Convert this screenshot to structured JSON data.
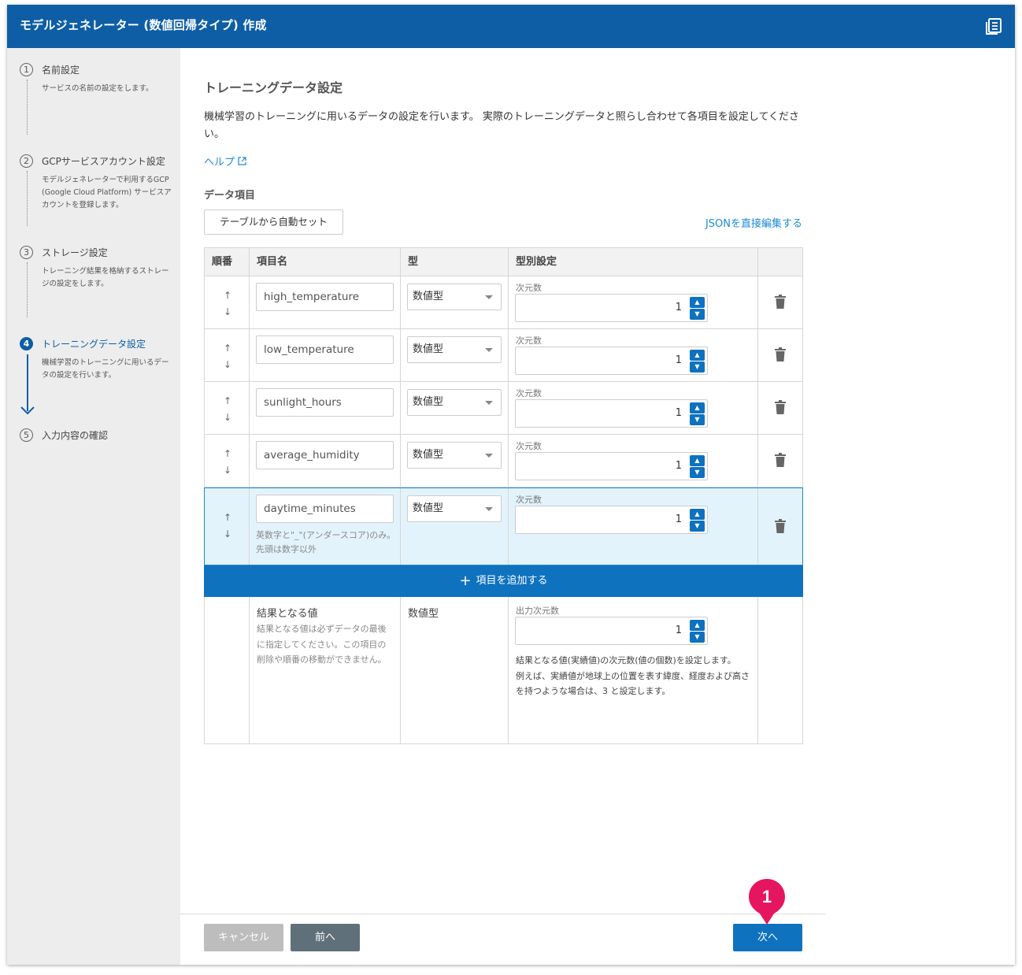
{
  "header": {
    "title": "モデルジェネレーター (数値回帰タイプ) 作成",
    "icon": "document-icon"
  },
  "sidebar": {
    "steps": [
      {
        "num": "1",
        "label": "名前設定",
        "desc": "サービスの名前の設定をします。"
      },
      {
        "num": "2",
        "label": "GCPサービスアカウント設定",
        "desc": "モデルジェネレーターで利用するGCP (Google Cloud Platform) サービスアカウントを登録します。"
      },
      {
        "num": "3",
        "label": "ストレージ設定",
        "desc": "トレーニング結果を格納するストレージの設定をします。"
      },
      {
        "num": "4",
        "label": "トレーニングデータ設定",
        "desc": "機械学習のトレーニングに用いるデータの設定を行います。"
      },
      {
        "num": "5",
        "label": "入力内容の確認",
        "desc": ""
      }
    ]
  },
  "main": {
    "title": "トレーニングデータ設定",
    "intro": "機械学習のトレーニングに用いるデータの設定を行います。 実際のトレーニングデータと照らし合わせて各項目を設定してください。",
    "help": "ヘルプ",
    "section": "データ項目",
    "auto_button": "テーブルから自動セット",
    "json_link": "JSONを直接編集する",
    "columns": {
      "order": "順番",
      "name": "項目名",
      "type": "型",
      "settings": "型別設定"
    },
    "dim_label": "次元数",
    "rows": [
      {
        "name": "high_temperature",
        "type": "数値型",
        "dim": "1"
      },
      {
        "name": "low_temperature",
        "type": "数値型",
        "dim": "1"
      },
      {
        "name": "sunlight_hours",
        "type": "数値型",
        "dim": "1"
      },
      {
        "name": "average_humidity",
        "type": "数値型",
        "dim": "1"
      },
      {
        "name": "daytime_minutes",
        "type": "数値型",
        "dim": "1",
        "hint": "英数字と\"_\"(アンダースコア)のみ。先頭は数字以外"
      }
    ],
    "add_item": "項目を追加する",
    "result": {
      "name": "結果となる値",
      "note": "結果となる値は必ずデータの最後に指定してください。この項目の削除や順番の移動ができません。",
      "type": "数値型",
      "dim_label": "出力次元数",
      "dim": "1",
      "desc": "結果となる値(実績値)の次元数(値の個数)を設定します。\n例えば、実績値が地球上の位置を表す緯度、経度および高さを持つような場合は、3 と設定します。"
    }
  },
  "footer": {
    "cancel": "キャンセル",
    "prev": "前へ",
    "next": "次へ",
    "badge": "1"
  },
  "colors": {
    "header": "#0e5ea6",
    "accent": "#0e72bf",
    "link": "#1a8ad4",
    "badge": "#e6155f",
    "selected_row": "#e3f3fc"
  }
}
